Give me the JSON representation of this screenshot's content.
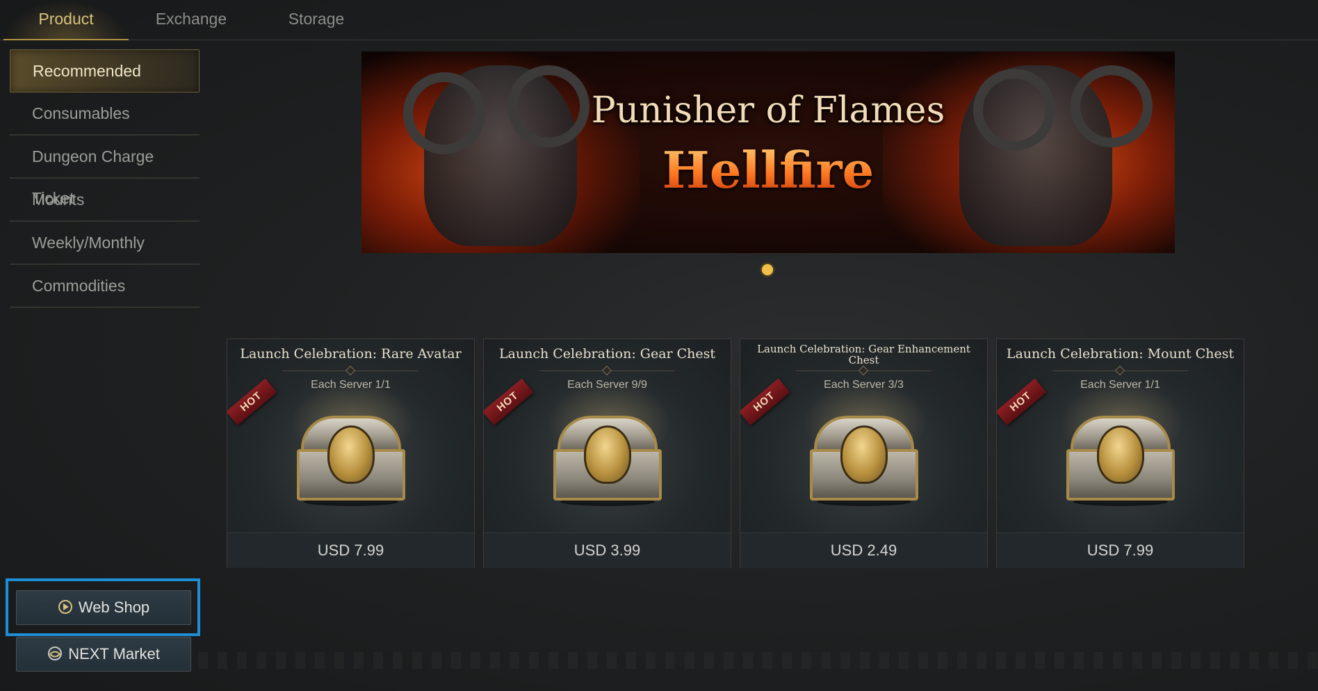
{
  "tabs": [
    {
      "label": "Product",
      "active": true
    },
    {
      "label": "Exchange",
      "active": false
    },
    {
      "label": "Storage",
      "active": false
    }
  ],
  "sidebar": {
    "items": [
      {
        "label": "Recommended",
        "active": true
      },
      {
        "label": "Consumables",
        "active": false
      },
      {
        "label": "Dungeon Charge Ticket",
        "active": false
      },
      {
        "label": "Mounts",
        "active": false
      },
      {
        "label": "Weekly/Monthly",
        "active": false
      },
      {
        "label": "Commodities",
        "active": false
      }
    ]
  },
  "banner": {
    "title_line1": "Punisher of Flames",
    "title_line2": "Hellfire",
    "slide_count": 1,
    "active_slide": 1
  },
  "products": [
    {
      "name": "Launch Celebration: Rare Avatar",
      "limit": "Each Server 1/1",
      "badge": "HOT",
      "price": "USD 7.99",
      "icon": "mask-chest-icon"
    },
    {
      "name": "Launch Celebration: Gear Chest",
      "limit": "Each Server 9/9",
      "badge": "HOT",
      "price": "USD 3.99",
      "icon": "helmet-chest-icon"
    },
    {
      "name": "Launch Celebration: Gear Enhancement Chest",
      "limit": "Each Server 3/3",
      "badge": "HOT",
      "price": "USD 2.49",
      "icon": "anvil-chest-icon"
    },
    {
      "name": "Launch Celebration: Mount Chest",
      "limit": "Each Server 1/1",
      "badge": "HOT",
      "price": "USD 7.99",
      "icon": "horse-chest-icon"
    }
  ],
  "buttons": {
    "web_shop": "Web Shop",
    "next_market": "NEXT Market"
  },
  "colors": {
    "accent_gold": "#d9c27e",
    "hot_badge": "#8a1e22",
    "highlight_border": "#1e8fd6",
    "pagination_dot": "#f0c04a"
  }
}
